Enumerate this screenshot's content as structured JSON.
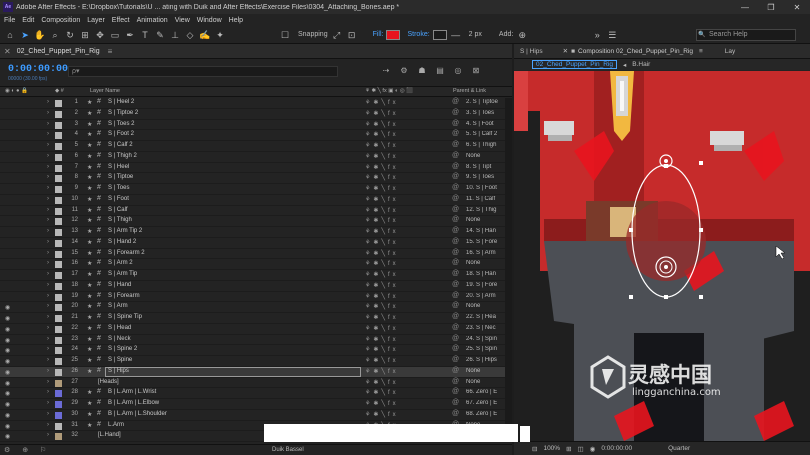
{
  "window": {
    "title": "Adobe After Effects - E:\\Dropbox\\Tutorials\\U ... ating with Duik and After Effects\\Exercise Files\\0304_Attaching_Bones.aep *",
    "app_icon": "Ae",
    "minimize": "—",
    "maximize": "❐",
    "close": "✕"
  },
  "menu": [
    "File",
    "Edit",
    "Composition",
    "Layer",
    "Effect",
    "Animation",
    "View",
    "Window",
    "Help"
  ],
  "toolbar": {
    "snapping": "Snapping",
    "fill": "Fill:",
    "stroke": "Stroke:",
    "stroke_width": "2 px",
    "add": "Add:",
    "search_help": "Search Help",
    "fill_color": "#e8141e"
  },
  "timeline": {
    "tab_name": "02_Ched_Puppet_Pin_Rig",
    "timecode": "0:00:00:00",
    "fps": "00000 (30.00 fps)",
    "search_placeholder": "ρ▾",
    "col_layer_name": "Layer Name",
    "col_parent": "Parent & Link",
    "duik_label": "Duik Bassel",
    "layers": [
      {
        "num": "1",
        "name": "S | Heel 2",
        "parent": "2. S | Tiptoe"
      },
      {
        "num": "2",
        "name": "S | Tiptoe 2",
        "parent": "3. S | Toes"
      },
      {
        "num": "3",
        "name": "S | Toes 2",
        "parent": "4. S | Foot"
      },
      {
        "num": "4",
        "name": "S | Foot 2",
        "parent": "5. S | Calf 2"
      },
      {
        "num": "5",
        "name": "S | Calf 2",
        "parent": "6. S | Thigh"
      },
      {
        "num": "6",
        "name": "S | Thigh 2",
        "parent": "None"
      },
      {
        "num": "7",
        "name": "S | Heel",
        "parent": "8. S | Tipt"
      },
      {
        "num": "8",
        "name": "S | Tiptoe",
        "parent": "9. S | Toes"
      },
      {
        "num": "9",
        "name": "S | Toes",
        "parent": "10. S | Foot"
      },
      {
        "num": "10",
        "name": "S | Foot",
        "parent": "11. S | Calf"
      },
      {
        "num": "11",
        "name": "S | Calf",
        "parent": "12. S | Thig"
      },
      {
        "num": "12",
        "name": "S | Thigh",
        "parent": "None"
      },
      {
        "num": "13",
        "name": "S | Arm Tip 2",
        "parent": "14. S | Han"
      },
      {
        "num": "14",
        "name": "S | Hand 2",
        "parent": "15. S | Fore"
      },
      {
        "num": "15",
        "name": "S | Forearm 2",
        "parent": "16. S | Arm"
      },
      {
        "num": "16",
        "name": "S | Arm 2",
        "parent": "None"
      },
      {
        "num": "17",
        "name": "S | Arm Tip",
        "parent": "18. S | Han"
      },
      {
        "num": "18",
        "name": "S | Hand",
        "parent": "19. S | Fore"
      },
      {
        "num": "19",
        "name": "S | Forearm",
        "parent": "20. S | Arm"
      },
      {
        "num": "20",
        "name": "S | Arm",
        "parent": "None"
      },
      {
        "num": "21",
        "name": "S | Spine Tip",
        "parent": "22. S | Hea"
      },
      {
        "num": "22",
        "name": "S | Head",
        "parent": "23. S | Nec"
      },
      {
        "num": "23",
        "name": "S | Neck",
        "parent": "24. S | Spin"
      },
      {
        "num": "24",
        "name": "S | Spine 2",
        "parent": "25. S | Spin"
      },
      {
        "num": "25",
        "name": "S | Spine",
        "parent": "26. S | Hips"
      },
      {
        "num": "26",
        "name": "S | Hips",
        "parent": "None"
      },
      {
        "num": "27",
        "name": "[Heads]",
        "parent": "None"
      },
      {
        "num": "28",
        "name": "B | L.Arm | L.Wrist",
        "parent": "66. Zero | E"
      },
      {
        "num": "29",
        "name": "B | L.Arm | L.Elbow",
        "parent": "67. Zero | E"
      },
      {
        "num": "30",
        "name": "B | L.Arm | L.Shoulder",
        "parent": "68. Zero | E"
      },
      {
        "num": "31",
        "name": "L.Arm",
        "parent": "None"
      },
      {
        "num": "32",
        "name": "[L.Hand]",
        "parent": "None"
      }
    ]
  },
  "viewer": {
    "tab_hips": "S | Hips",
    "tab_comp": "Composition 02_Ched_Puppet_Pin_Rig",
    "tab_lay": "Lay",
    "crumb_active": "02_Ched_Puppet_Pin_Rig",
    "crumb_next": "B.Hair",
    "zoom": "100%",
    "timecode": "0:00:00:00",
    "resolution": "Quarter"
  },
  "watermark": {
    "text": "灵感中国",
    "url": "lingganchina.com"
  }
}
